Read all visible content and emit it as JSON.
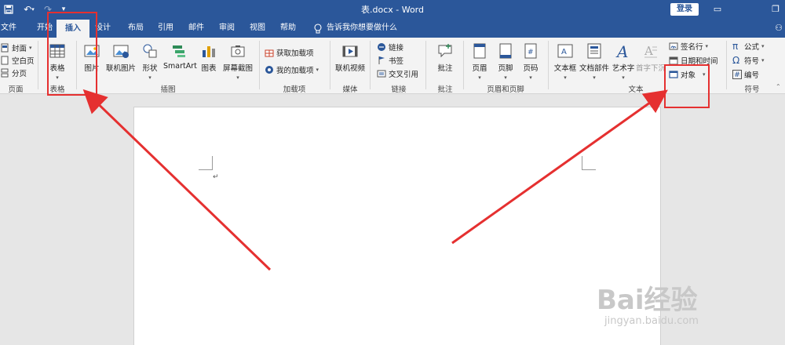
{
  "titlebar": {
    "title": "表.docx - Word",
    "login_label": "登录"
  },
  "tabs": [
    {
      "id": "file",
      "label": "文件"
    },
    {
      "id": "home",
      "label": "开始"
    },
    {
      "id": "insert",
      "label": "插入"
    },
    {
      "id": "design",
      "label": "设计"
    },
    {
      "id": "layout",
      "label": "布局"
    },
    {
      "id": "references",
      "label": "引用"
    },
    {
      "id": "mailings",
      "label": "邮件"
    },
    {
      "id": "review",
      "label": "审阅"
    },
    {
      "id": "view",
      "label": "视图"
    },
    {
      "id": "help",
      "label": "帮助"
    }
  ],
  "tell_me": "告诉我你想要做什么",
  "ribbon": {
    "pages": {
      "items": [
        "封面",
        "空白页",
        "分页"
      ],
      "label": "页面"
    },
    "tables": {
      "button": "表格",
      "label": "表格"
    },
    "illustrations": {
      "buttons": [
        "图片",
        "联机图片",
        "形状",
        "SmartArt",
        "图表",
        "屏幕截图"
      ],
      "label": "插图"
    },
    "addins": {
      "items": [
        "获取加载项",
        "我的加载项"
      ],
      "label": "加载项"
    },
    "media": {
      "button": "联机视频",
      "label": "媒体"
    },
    "links": {
      "items": [
        "链接",
        "书签",
        "交叉引用"
      ],
      "label": "链接"
    },
    "comments": {
      "button": "批注",
      "label": "批注"
    },
    "header_footer": {
      "buttons": [
        "页眉",
        "页脚",
        "页码"
      ],
      "label": "页眉和页脚"
    },
    "text": {
      "buttons": [
        "文本框",
        "文档部件",
        "艺术字",
        "首字下沉"
      ],
      "side_items": [
        "签名行",
        "日期和时间",
        "对象"
      ],
      "label": "文本"
    },
    "symbols": {
      "items": [
        "公式",
        "符号",
        "编号"
      ],
      "label": "符号"
    }
  },
  "document": {
    "paragraph_mark": "↵"
  },
  "watermark": {
    "brand": "Bai经验",
    "url": "jingyan.baidu.com"
  },
  "colors": {
    "accent": "#2b579a",
    "annotation": "#e53030"
  }
}
